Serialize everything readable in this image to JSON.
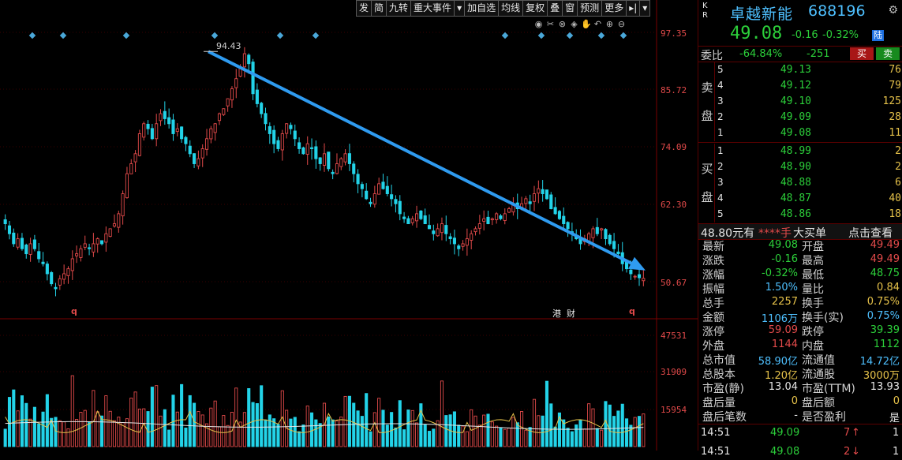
{
  "toolbar": {
    "buttons": [
      "发",
      "简",
      "九转",
      "重大事件",
      "▾",
      "加自选",
      "均线",
      "复权",
      "叠",
      "窗",
      "预测",
      "更多",
      "▸|",
      "▾"
    ]
  },
  "tool_icons": [
    "eye-icon",
    "scissors-icon",
    "close-circle-icon",
    "diamond-icon",
    "hand-icon",
    "undo-icon",
    "zoom-in-icon",
    "zoom-out-icon"
  ],
  "tool_glyphs": [
    "◉",
    "✂",
    "⊗",
    "◈",
    "✋",
    "↶",
    "⊕",
    "⊖"
  ],
  "price_axis": [
    "97.35",
    "85.72",
    "74.09",
    "62.30",
    "50.67"
  ],
  "volume_axis": [
    "47531",
    "31909",
    "15954"
  ],
  "peak_label": "94.43",
  "markers": {
    "q1": "q",
    "q2": "q",
    "gang": "港",
    "cai": "财"
  },
  "colors": {
    "up": "#e24a4a",
    "down": "#2ccf3a",
    "accent": "#4ec0ff",
    "arrow": "#2f9bf0",
    "yellow": "#e6c24a"
  },
  "chart_data": {
    "type": "candlestick",
    "trend_arrow": {
      "from_price": 94.43,
      "to_price": 50.67
    },
    "ylim": [
      44,
      100
    ],
    "volume_ylim": [
      0,
      62000
    ],
    "closes": [
      60,
      58,
      56,
      57,
      55,
      54,
      56,
      55,
      53,
      52,
      50,
      48,
      47,
      49,
      50,
      51,
      53,
      54,
      55,
      56,
      55,
      56,
      57,
      56,
      58,
      59,
      60,
      62,
      66,
      70,
      72,
      74,
      78,
      80,
      79,
      77,
      80,
      82,
      81,
      80,
      78,
      79,
      77,
      76,
      74,
      72,
      73,
      75,
      77,
      79,
      80,
      82,
      83,
      85,
      87,
      89,
      91,
      94,
      92,
      86,
      84,
      82,
      80,
      78,
      76,
      75,
      78,
      80,
      79,
      77,
      75,
      74,
      76,
      75,
      73,
      72,
      74,
      71,
      70,
      72,
      73,
      74,
      72,
      70,
      68,
      67,
      65,
      64,
      66,
      68,
      67,
      66,
      65,
      64,
      62,
      61,
      60,
      61,
      62,
      61,
      60,
      59,
      58,
      59,
      60,
      58,
      57,
      56,
      55,
      56,
      57,
      58,
      59,
      60,
      61,
      60,
      61,
      62,
      61,
      62,
      63,
      64,
      63,
      64,
      65,
      64,
      66,
      67,
      66,
      65,
      63,
      62,
      61,
      60,
      59,
      58,
      57,
      56,
      57,
      58,
      59,
      58,
      59,
      57,
      56,
      55,
      54,
      52,
      51,
      50,
      49.5,
      49.2,
      49.08
    ]
  },
  "stock": {
    "kr": "K R",
    "name": "卓越新能",
    "code": "688196",
    "price": "49.08",
    "change": "-0.16",
    "change_pct": "-0.32%",
    "badge": "陆"
  },
  "weibi": {
    "label": "委比",
    "value": "-64.84%",
    "diff": "-251",
    "buy": "买",
    "sell": "卖"
  },
  "sell_label": [
    "卖",
    "盘"
  ],
  "buy_label": [
    "买",
    "盘"
  ],
  "asks": [
    {
      "lvl": "5",
      "price": "49.13",
      "vol": "76"
    },
    {
      "lvl": "4",
      "price": "49.12",
      "vol": "79"
    },
    {
      "lvl": "3",
      "price": "49.10",
      "vol": "125"
    },
    {
      "lvl": "2",
      "price": "49.09",
      "vol": "28"
    },
    {
      "lvl": "1",
      "price": "49.08",
      "vol": "11"
    }
  ],
  "bids": [
    {
      "lvl": "1",
      "price": "48.99",
      "vol": "2"
    },
    {
      "lvl": "2",
      "price": "48.90",
      "vol": "2"
    },
    {
      "lvl": "3",
      "price": "48.88",
      "vol": "6"
    },
    {
      "lvl": "4",
      "price": "48.87",
      "vol": "40"
    },
    {
      "lvl": "5",
      "price": "48.86",
      "vol": "18"
    }
  ],
  "bigorder": {
    "price_text": "48.80元有",
    "stars": "****手",
    "label": "大买单",
    "link": "点击查看"
  },
  "stats": [
    {
      "l1": "最新",
      "v1": "49.08",
      "c1": "green",
      "l2": "开盘",
      "v2": "49.49",
      "c2": "red"
    },
    {
      "l1": "涨跌",
      "v1": "-0.16",
      "c1": "green",
      "l2": "最高",
      "v2": "49.49",
      "c2": "red"
    },
    {
      "l1": "涨幅",
      "v1": "-0.32%",
      "c1": "green",
      "l2": "最低",
      "v2": "48.75",
      "c2": "green"
    },
    {
      "l1": "振幅",
      "v1": "1.50%",
      "c1": "cyan",
      "l2": "量比",
      "v2": "0.84",
      "c2": "yel"
    },
    {
      "l1": "总手",
      "v1": "2257",
      "c1": "yel",
      "l2": "换手",
      "v2": "0.75%",
      "c2": "yel"
    },
    {
      "l1": "金额",
      "v1": "1106万",
      "c1": "cyan",
      "l2": "换手(实)",
      "v2": "0.75%",
      "c2": "cyan"
    },
    {
      "l1": "涨停",
      "v1": "59.09",
      "c1": "red",
      "l2": "跌停",
      "v2": "39.39",
      "c2": "green"
    },
    {
      "l1": "外盘",
      "v1": "1144",
      "c1": "red",
      "l2": "内盘",
      "v2": "1112",
      "c2": "green"
    },
    {
      "l1": "总市值",
      "v1": "58.90亿",
      "c1": "cyan",
      "l2": "流通值",
      "v2": "14.72亿",
      "c2": "cyan"
    },
    {
      "l1": "总股本",
      "v1": "1.20亿",
      "c1": "yel",
      "l2": "流通股",
      "v2": "3000万",
      "c2": "yel"
    },
    {
      "l1": "市盈(静)",
      "v1": "13.04",
      "c1": "wht",
      "l2": "市盈(TTM)",
      "v2": "13.93",
      "c2": "wht"
    },
    {
      "l1": "盘后量",
      "v1": "0",
      "c1": "yel",
      "l2": "盘后额",
      "v2": "0",
      "c2": "yel"
    },
    {
      "l1": "盘后笔数",
      "v1": "-",
      "c1": "wht",
      "l2": "是否盈利",
      "v2": "是",
      "c2": "wht"
    }
  ],
  "ticks": [
    {
      "time": "14:51",
      "price": "49.09",
      "vol": "7",
      "arrow": "↑",
      "count": "1"
    },
    {
      "time": "14:51",
      "price": "49.08",
      "vol": "2",
      "arrow": "↓",
      "count": "1"
    }
  ]
}
